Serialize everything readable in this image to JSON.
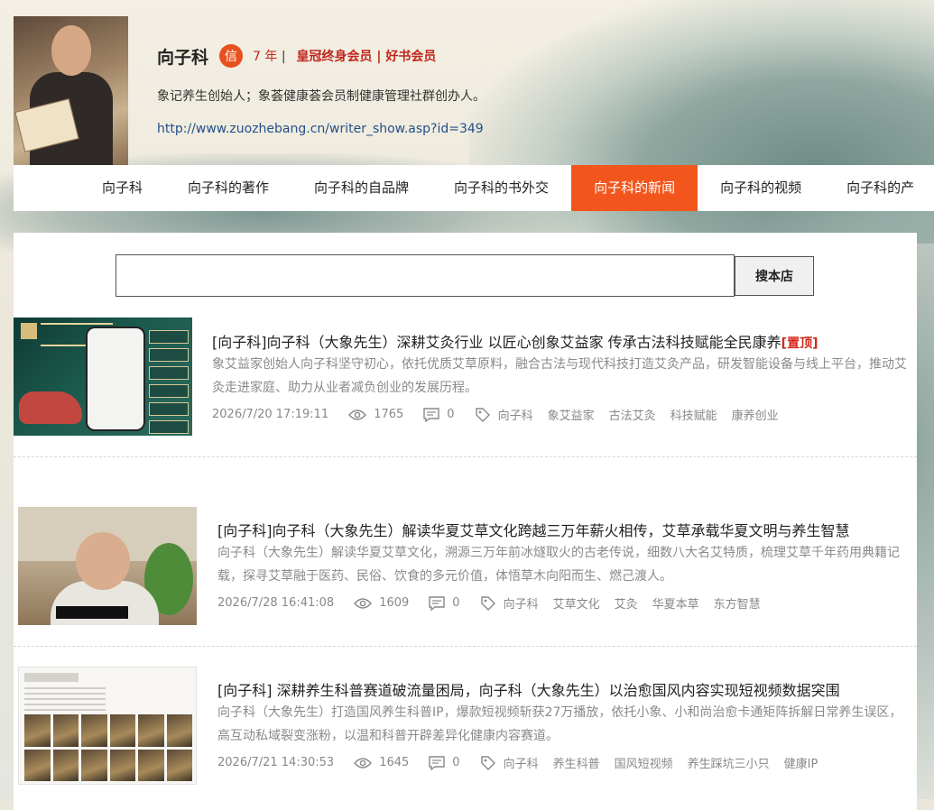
{
  "profile": {
    "name": "向子科",
    "badge": "信",
    "years": "7 年",
    "years_sep": "|",
    "membership": "皇冠终身会员 | 好书会员",
    "bio": "象记养生创始人；象荟健康荟会员制健康管理社群创办人。",
    "link": "http://www.zuozhebang.cn/writer_show.asp?id=349"
  },
  "nav": [
    {
      "label": "向子科"
    },
    {
      "label": "向子科的著作"
    },
    {
      "label": "向子科的自品牌"
    },
    {
      "label": "向子科的书外交"
    },
    {
      "label": "向子科的新闻"
    },
    {
      "label": "向子科的视频"
    },
    {
      "label": "向子科的产"
    }
  ],
  "search": {
    "value": "",
    "button": "搜本店"
  },
  "articles": [
    {
      "title": "[向子科]向子科（大象先生）深耕艾灸行业 以匠心创象艾益家 传承古法科技赋能全民康养",
      "pin": "[置顶]",
      "desc": "象艾益家创始人向子科坚守初心，依托优质艾草原料，融合古法与现代科技打造艾灸产品，研发智能设备与线上平台，推动艾灸走进家庭、助力从业者减负创业的发展历程。",
      "date": "2026/7/20 17:19:11",
      "views": "1765",
      "comments": "0",
      "tags": [
        "向子科",
        "象艾益家",
        "古法艾灸",
        "科技赋能",
        "康养创业"
      ]
    },
    {
      "title": "[向子科]向子科（大象先生）解读华夏艾草文化跨越三万年薪火相传，艾草承载华夏文明与养生智慧",
      "desc": "向子科（大象先生）解读华夏艾草文化，溯源三万年前冰燧取火的古老传说，细数八大名艾特质，梳理艾草千年药用典籍记载，探寻艾草融于医药、民俗、饮食的多元价值，体悟草木向阳而生、燃己渡人。",
      "date": "2026/7/28 16:41:08",
      "views": "1609",
      "comments": "0",
      "tags": [
        "向子科",
        "艾草文化",
        "艾灸",
        "华夏本草",
        "东方智慧"
      ]
    },
    {
      "title": "[向子科] 深耕养生科普赛道破流量困局，向子科（大象先生）以治愈国风内容实现短视频数据突围",
      "desc": "向子科（大象先生）打造国风养生科普IP，爆款短视频斩获27万播放，依托小象、小和尚治愈卡通矩阵拆解日常养生误区，高互动私域裂变涨粉，以温和科普开辟差异化健康内容赛道。",
      "date": "2026/7/21 14:30:53",
      "views": "1645",
      "comments": "0",
      "tags": [
        "向子科",
        "养生科普",
        "国风短视频",
        "养生踩坑三小只",
        "健康IP"
      ]
    }
  ],
  "colors": {
    "accent": "#f3561c",
    "vip_red": "#c1261d",
    "link_blue": "#244f8a",
    "pin_red": "#d2281c"
  }
}
